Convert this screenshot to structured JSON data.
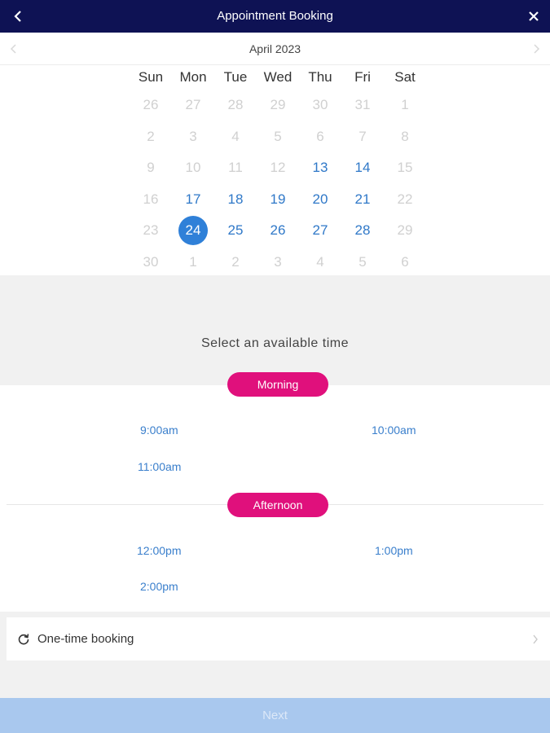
{
  "header": {
    "title": "Appointment Booking",
    "back_icon": "chevron-left-icon",
    "close_icon": "close-icon"
  },
  "calendar": {
    "month_label": "April 2023",
    "weekdays": [
      "Sun",
      "Mon",
      "Tue",
      "Wed",
      "Thu",
      "Fri",
      "Sat"
    ],
    "weeks": [
      [
        {
          "d": "26",
          "s": "muted"
        },
        {
          "d": "27",
          "s": "muted"
        },
        {
          "d": "28",
          "s": "muted"
        },
        {
          "d": "29",
          "s": "muted"
        },
        {
          "d": "30",
          "s": "muted"
        },
        {
          "d": "31",
          "s": "muted"
        },
        {
          "d": "1",
          "s": "muted"
        }
      ],
      [
        {
          "d": "2",
          "s": "muted"
        },
        {
          "d": "3",
          "s": "muted"
        },
        {
          "d": "4",
          "s": "muted"
        },
        {
          "d": "5",
          "s": "muted"
        },
        {
          "d": "6",
          "s": "muted"
        },
        {
          "d": "7",
          "s": "muted"
        },
        {
          "d": "8",
          "s": "muted"
        }
      ],
      [
        {
          "d": "9",
          "s": "muted"
        },
        {
          "d": "10",
          "s": "muted"
        },
        {
          "d": "11",
          "s": "muted"
        },
        {
          "d": "12",
          "s": "muted"
        },
        {
          "d": "13",
          "s": "avail"
        },
        {
          "d": "14",
          "s": "avail"
        },
        {
          "d": "15",
          "s": "muted"
        }
      ],
      [
        {
          "d": "16",
          "s": "muted"
        },
        {
          "d": "17",
          "s": "avail"
        },
        {
          "d": "18",
          "s": "avail"
        },
        {
          "d": "19",
          "s": "avail"
        },
        {
          "d": "20",
          "s": "avail"
        },
        {
          "d": "21",
          "s": "avail"
        },
        {
          "d": "22",
          "s": "muted"
        }
      ],
      [
        {
          "d": "23",
          "s": "muted"
        },
        {
          "d": "24",
          "s": "selected"
        },
        {
          "d": "25",
          "s": "avail"
        },
        {
          "d": "26",
          "s": "avail"
        },
        {
          "d": "27",
          "s": "avail"
        },
        {
          "d": "28",
          "s": "avail"
        },
        {
          "d": "29",
          "s": "muted"
        }
      ],
      [
        {
          "d": "30",
          "s": "muted"
        },
        {
          "d": "1",
          "s": "muted"
        },
        {
          "d": "2",
          "s": "muted"
        },
        {
          "d": "3",
          "s": "muted"
        },
        {
          "d": "4",
          "s": "muted"
        },
        {
          "d": "5",
          "s": "muted"
        },
        {
          "d": "6",
          "s": "muted"
        }
      ]
    ]
  },
  "time_selection": {
    "prompt": "Select an available time",
    "morning": {
      "label": "Morning",
      "slots": [
        "9:00am",
        "10:00am",
        "11:00am"
      ]
    },
    "afternoon": {
      "label": "Afternoon",
      "slots": [
        "12:00pm",
        "1:00pm",
        "2:00pm"
      ]
    }
  },
  "booking_type": {
    "label": "One-time booking",
    "icon": "refresh-icon"
  },
  "footer": {
    "next_label": "Next"
  },
  "colors": {
    "header_bg": "#0e1254",
    "accent": "#e0107c",
    "link": "#3a7fcc",
    "selected_day": "#2f80d8",
    "next_disabled": "#a9c8ee"
  }
}
